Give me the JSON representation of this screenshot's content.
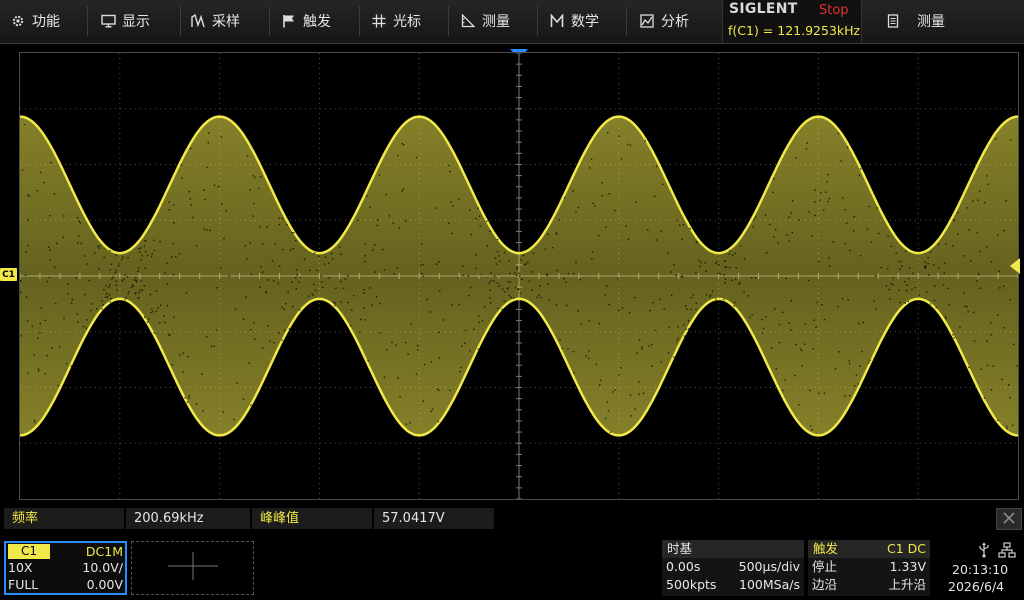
{
  "menu": {
    "items": [
      {
        "id": "utility",
        "label": "功能",
        "icon": "gear-icon"
      },
      {
        "id": "display",
        "label": "显示",
        "icon": "monitor-icon"
      },
      {
        "id": "acquire",
        "label": "采样",
        "icon": "acquire-icon"
      },
      {
        "id": "trigger",
        "label": "触发",
        "icon": "flag-icon"
      },
      {
        "id": "cursors",
        "label": "光标",
        "icon": "cursor-icon"
      },
      {
        "id": "measure",
        "label": "测量",
        "icon": "ruler-icon"
      },
      {
        "id": "math",
        "label": "数学",
        "icon": "math-icon"
      },
      {
        "id": "analysis",
        "label": "分析",
        "icon": "analysis-icon"
      }
    ],
    "right_menu": {
      "label": "测量",
      "icon": "clipboard-icon"
    }
  },
  "brand": {
    "name": "SIGLENT",
    "run_state": "Stop",
    "freq_readout": "f(C1) = 121.9253kHz"
  },
  "markers": {
    "channel_marker": "C1"
  },
  "measurements": {
    "m1": {
      "label": "频率",
      "value": "200.69kHz"
    },
    "m2": {
      "label": "峰峰值",
      "value": "57.0417V"
    }
  },
  "channel1": {
    "name": "C1",
    "coupling": "DC1M",
    "probe": "10X",
    "scale": "10.0V/",
    "bandwidth": "FULL",
    "offset": "0.00V"
  },
  "timebase": {
    "title": "时基",
    "delay": "0.00s",
    "scale": "500µs/div",
    "memory": "500kpts",
    "sample_rate": "100MSa/s"
  },
  "trigger": {
    "title": "触发",
    "source": "C1 DC",
    "mode": "停止",
    "level": "1.33V",
    "type": "边沿",
    "slope": "上升沿"
  },
  "system": {
    "time": "20:13:10",
    "date": "2026/6/4"
  },
  "colors": {
    "trace": "#f1e94a",
    "accent": "#2a8cff",
    "stop": "#e23030",
    "grid": "#5a5a5a"
  },
  "chart_data": {
    "type": "line",
    "title": "",
    "series": [
      {
        "name": "C1",
        "color": "#f1e94a",
        "x": [
          0,
          0.5,
          1,
          1.5,
          2,
          2.5,
          3,
          3.5,
          4,
          4.5,
          5
        ],
        "y_upper": [
          28.6,
          4.1,
          28.6,
          4.1,
          28.6,
          4.1,
          28.6,
          4.1,
          28.6,
          4.1,
          28.6
        ],
        "y_lower": [
          -28.6,
          -4.1,
          -28.6,
          -4.1,
          -28.6,
          -4.1,
          -28.6,
          -4.1,
          -28.6,
          -4.1,
          -28.6
        ]
      }
    ],
    "xlabel": "",
    "ylabel": "",
    "xlim": [
      0,
      5
    ],
    "ylim": [
      -40,
      40
    ],
    "grid": true
  }
}
